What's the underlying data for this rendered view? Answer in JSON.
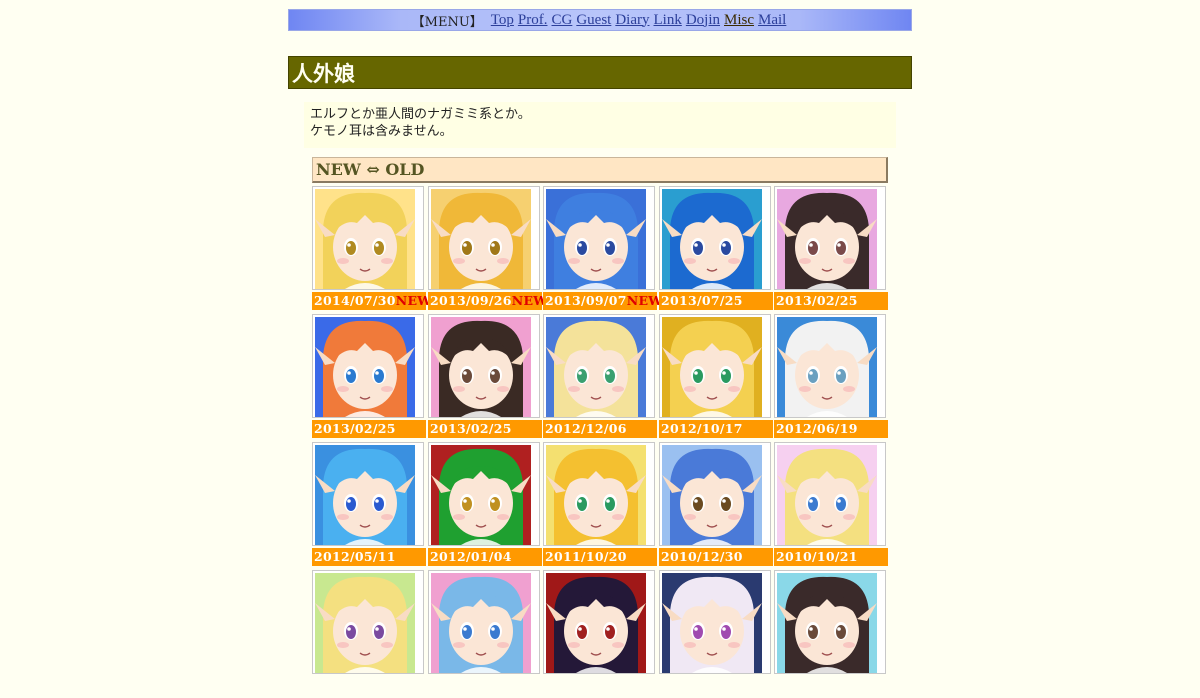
{
  "menu": {
    "label": "【MENU】",
    "links": [
      "Top",
      "Prof.",
      "CG",
      "Guest",
      "Diary",
      "Link",
      "Dojin",
      "Misc",
      "Mail"
    ]
  },
  "page_title": "人外娘",
  "description": [
    "エルフとか亜人間のナガミミ系とか。",
    "ケモノ耳は含みません。"
  ],
  "gallery": {
    "header": "NEW ⇔ OLD",
    "new_badge": "NEW",
    "items": [
      {
        "date": "2014/07/30",
        "new": true,
        "bg": "#ffe28a",
        "hair": "#f2d25a",
        "eye": "#b08a20"
      },
      {
        "date": "2013/09/26",
        "new": true,
        "bg": "#f6d070",
        "hair": "#f0b838",
        "eye": "#a07818"
      },
      {
        "date": "2013/09/07",
        "new": true,
        "bg": "#3a70d8",
        "hair": "#3f7fe0",
        "eye": "#2a4aa0"
      },
      {
        "date": "2013/07/25",
        "new": false,
        "bg": "#2a9ed0",
        "hair": "#1c6ad0",
        "eye": "#2a4aa0"
      },
      {
        "date": "2013/02/25",
        "new": false,
        "bg": "#e8a8e0",
        "hair": "#3a2a2a",
        "eye": "#7a4a4a"
      },
      {
        "date": "2013/02/25",
        "new": false,
        "bg": "#3a6ae8",
        "hair": "#f07a3a",
        "eye": "#2a7ad0"
      },
      {
        "date": "2013/02/25",
        "new": false,
        "bg": "#f0a0d0",
        "hair": "#3a2a24",
        "eye": "#6a4a3a"
      },
      {
        "date": "2012/12/06",
        "new": false,
        "bg": "#4a7ad8",
        "hair": "#f4e29a",
        "eye": "#3aa070"
      },
      {
        "date": "2012/10/17",
        "new": false,
        "bg": "#e0b020",
        "hair": "#f4d050",
        "eye": "#2a9a60"
      },
      {
        "date": "2012/06/19",
        "new": false,
        "bg": "#3a8ad8",
        "hair": "#f2f2f2",
        "eye": "#6aa0c0"
      },
      {
        "date": "2012/05/11",
        "new": false,
        "bg": "#3a90e0",
        "hair": "#4ab0f0",
        "eye": "#2a5ad0"
      },
      {
        "date": "2012/01/04",
        "new": false,
        "bg": "#b02020",
        "hair": "#1fa030",
        "eye": "#c09020"
      },
      {
        "date": "2011/10/20",
        "new": false,
        "bg": "#f4e070",
        "hair": "#f4c030",
        "eye": "#2a9a60"
      },
      {
        "date": "2010/12/30",
        "new": false,
        "bg": "#9ac0f0",
        "hair": "#4a7ad8",
        "eye": "#6a4a20"
      },
      {
        "date": "2010/10/21",
        "new": false,
        "bg": "#f6d0f0",
        "hair": "#f4e080",
        "eye": "#3a7ad0"
      },
      {
        "date": "",
        "new": false,
        "bg": "#c8e890",
        "hair": "#f4e080",
        "eye": "#7a4aa0"
      },
      {
        "date": "",
        "new": false,
        "bg": "#f0a0d0",
        "hair": "#7ab8e8",
        "eye": "#3a7ad0"
      },
      {
        "date": "",
        "new": false,
        "bg": "#a01818",
        "hair": "#241838",
        "eye": "#a02020"
      },
      {
        "date": "",
        "new": false,
        "bg": "#2a3a70",
        "hair": "#f0e8f4",
        "eye": "#a04ab0"
      },
      {
        "date": "",
        "new": false,
        "bg": "#8ad8e8",
        "hair": "#3a2a2a",
        "eye": "#6a4a3a"
      }
    ]
  }
}
